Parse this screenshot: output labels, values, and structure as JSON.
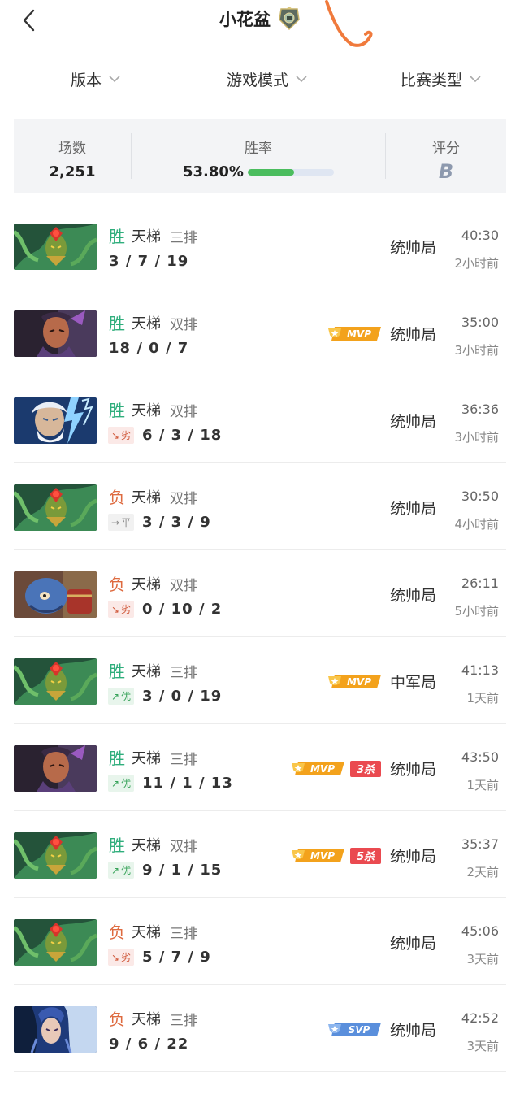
{
  "header": {
    "title": "小花盆",
    "back_icon": "chevron-left-icon",
    "rank_icon": "rank-medal-icon"
  },
  "filters": [
    {
      "label": "版本"
    },
    {
      "label": "游戏模式"
    },
    {
      "label": "比赛类型"
    }
  ],
  "stats": {
    "games_label": "场数",
    "games_value": "2,251",
    "winrate_label": "胜率",
    "winrate_value": "53.80%",
    "winrate_fraction": 0.538,
    "rating_label": "评分",
    "rating_value": "B"
  },
  "colors": {
    "win": "#2fae7c",
    "loss": "#de6a3f",
    "bar_fill": "#4bbd5e",
    "mvp_gold": "#f3a21c",
    "kill_red": "#ea4a50",
    "svp_blue": "#5a8fdc"
  },
  "matches": [
    {
      "hero": "medusa",
      "result": "胜",
      "outcome": "win",
      "mode": "天梯",
      "party": "三排",
      "perf": "",
      "kda": "3 / 7 / 19",
      "badges": [],
      "tier": "统帅局",
      "duration": "40:30",
      "ago": "2小时前"
    },
    {
      "hero": "anti-mage",
      "result": "胜",
      "outcome": "win",
      "mode": "天梯",
      "party": "双排",
      "perf": "",
      "kda": "18 / 0 / 7",
      "badges": [
        "MVP"
      ],
      "tier": "统帅局",
      "duration": "35:00",
      "ago": "3小时前"
    },
    {
      "hero": "zeus",
      "result": "胜",
      "outcome": "win",
      "mode": "天梯",
      "party": "双排",
      "perf": "劣",
      "perf_kind": "bad",
      "kda": "6 / 3 / 18",
      "badges": [],
      "tier": "统帅局",
      "duration": "36:36",
      "ago": "3小时前"
    },
    {
      "hero": "medusa",
      "result": "负",
      "outcome": "loss",
      "mode": "天梯",
      "party": "双排",
      "perf": "平",
      "perf_kind": "flat",
      "kda": "3 / 3 / 9",
      "badges": [],
      "tier": "统帅局",
      "duration": "30:50",
      "ago": "4小时前"
    },
    {
      "hero": "ogre-magi",
      "result": "负",
      "outcome": "loss",
      "mode": "天梯",
      "party": "双排",
      "perf": "劣",
      "perf_kind": "bad",
      "kda": "0 / 10 / 2",
      "badges": [],
      "tier": "统帅局",
      "duration": "26:11",
      "ago": "5小时前"
    },
    {
      "hero": "medusa",
      "result": "胜",
      "outcome": "win",
      "mode": "天梯",
      "party": "三排",
      "perf": "优",
      "perf_kind": "good",
      "kda": "3 / 0 / 19",
      "badges": [
        "MVP"
      ],
      "tier": "中军局",
      "duration": "41:13",
      "ago": "1天前"
    },
    {
      "hero": "anti-mage",
      "result": "胜",
      "outcome": "win",
      "mode": "天梯",
      "party": "三排",
      "perf": "优",
      "perf_kind": "good",
      "kda": "11 / 1 / 13",
      "badges": [
        "MVP",
        "3杀"
      ],
      "tier": "统帅局",
      "duration": "43:50",
      "ago": "1天前"
    },
    {
      "hero": "medusa",
      "result": "胜",
      "outcome": "win",
      "mode": "天梯",
      "party": "双排",
      "perf": "优",
      "perf_kind": "good",
      "kda": "9 / 1 / 15",
      "badges": [
        "MVP",
        "5杀"
      ],
      "tier": "统帅局",
      "duration": "35:37",
      "ago": "2天前"
    },
    {
      "hero": "medusa",
      "result": "负",
      "outcome": "loss",
      "mode": "天梯",
      "party": "三排",
      "perf": "劣",
      "perf_kind": "bad",
      "kda": "5 / 7 / 9",
      "badges": [],
      "tier": "统帅局",
      "duration": "45:06",
      "ago": "3天前"
    },
    {
      "hero": "luna",
      "result": "负",
      "outcome": "loss",
      "mode": "天梯",
      "party": "三排",
      "perf": "",
      "kda": "9 / 6 / 22",
      "badges": [
        "SVP"
      ],
      "tier": "统帅局",
      "duration": "42:52",
      "ago": "3天前"
    }
  ]
}
